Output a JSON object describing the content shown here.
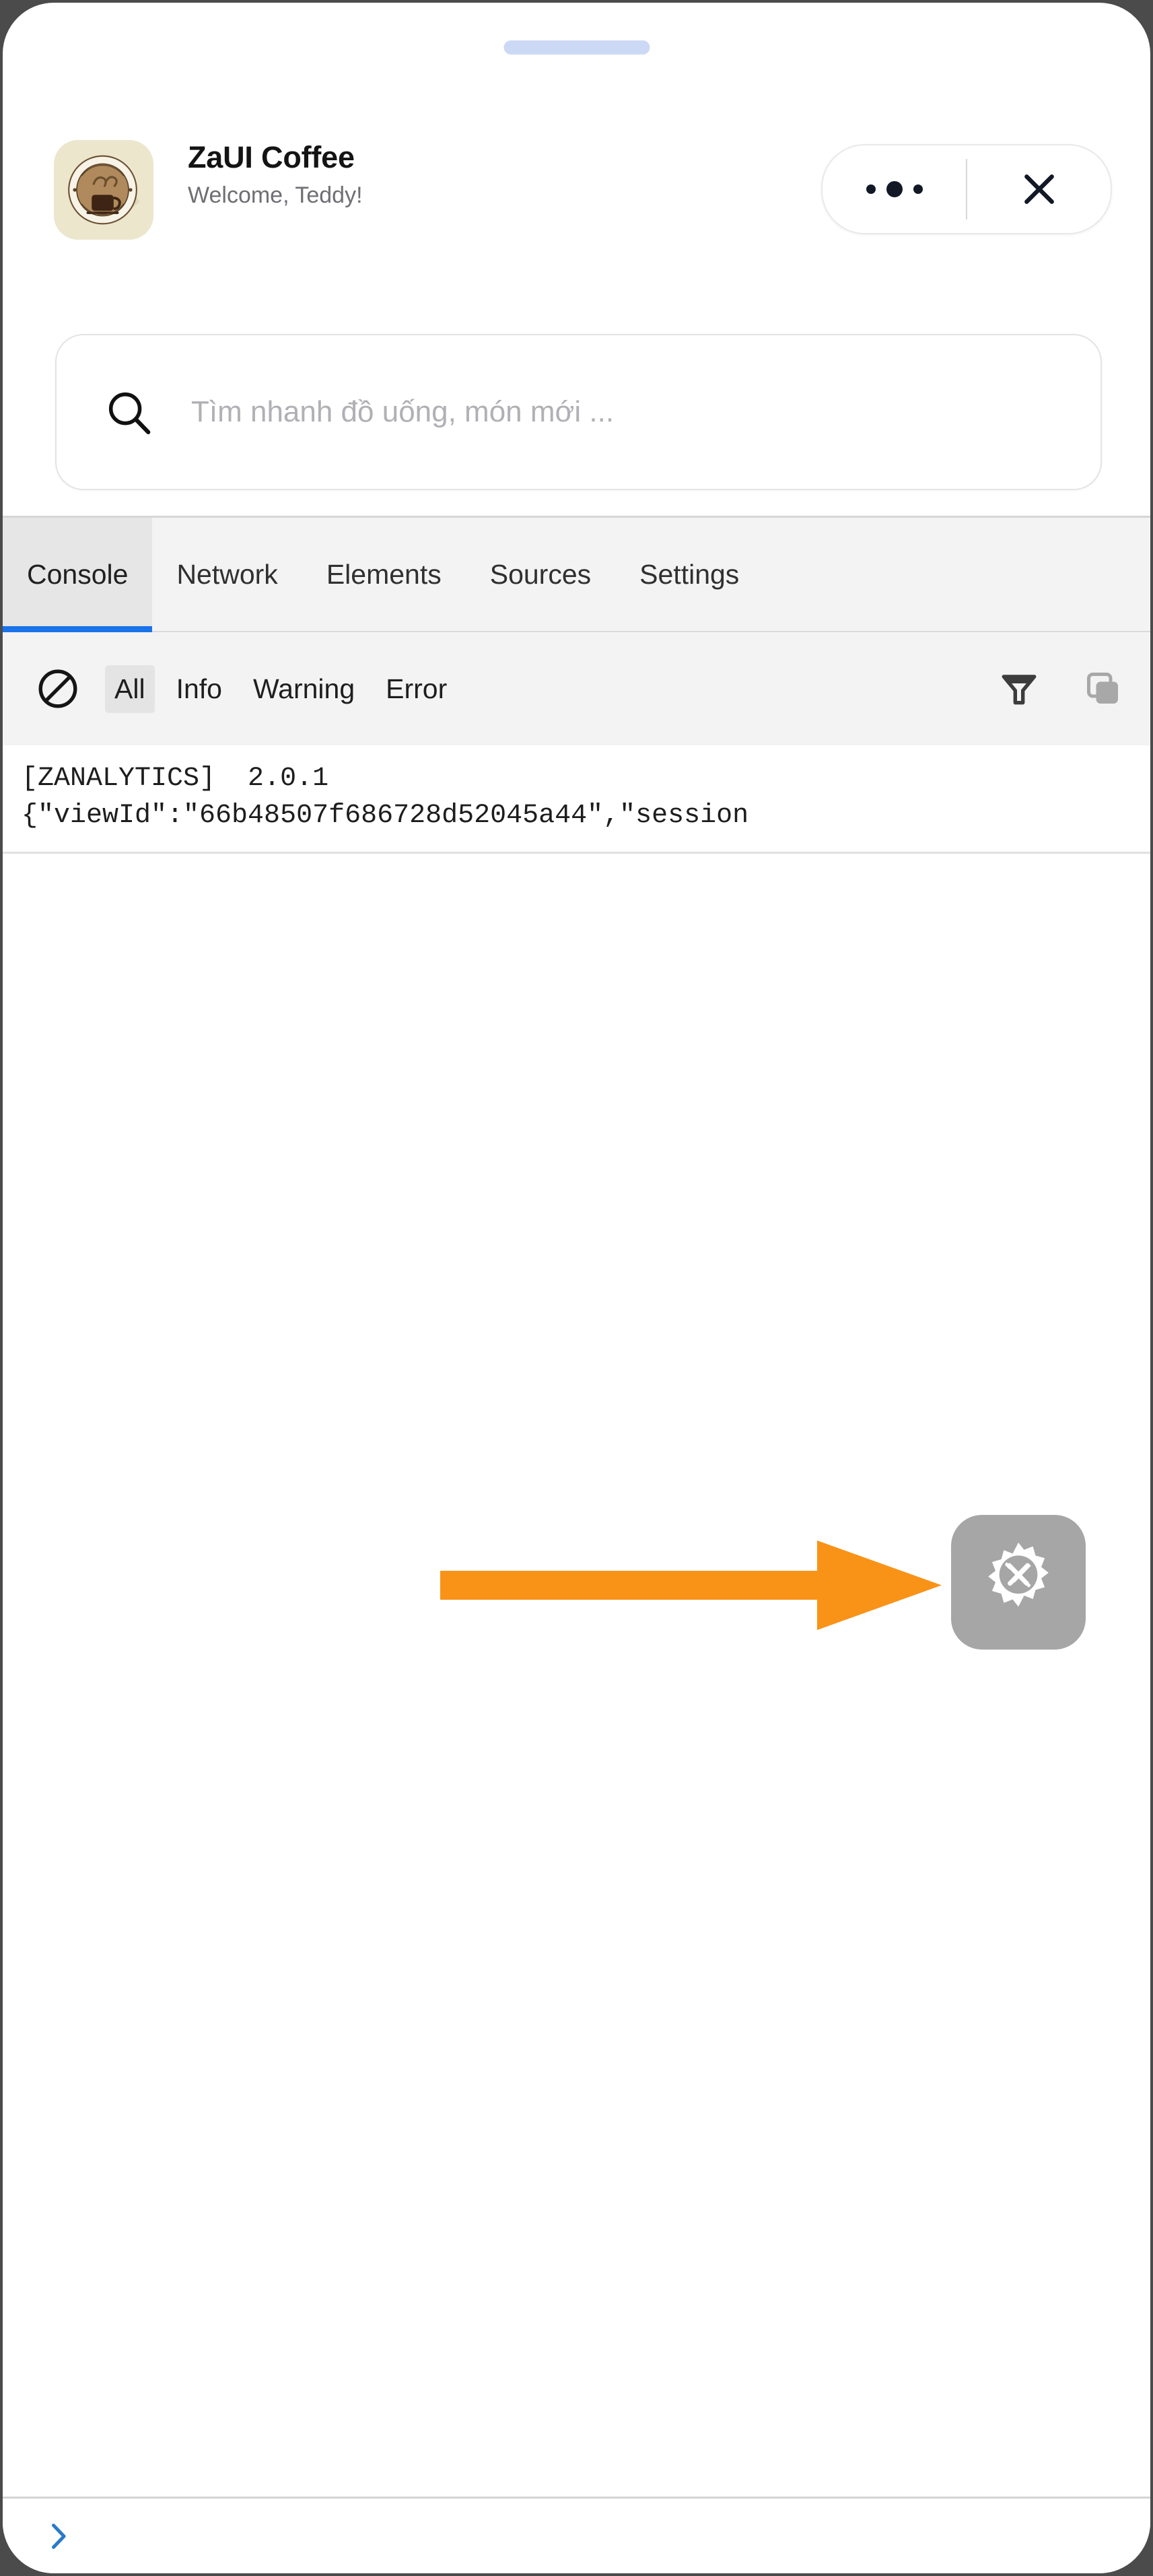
{
  "window": {
    "outer_background": "#4b4b4b",
    "frame_background": "#ffffff",
    "drag_handle_color": "#ccd9f5"
  },
  "app_header": {
    "logo_name": "zaui-coffee-logo",
    "logo_background": "#ece6cd",
    "title": "ZaUI Coffee",
    "subtitle": "Welcome, Teddy!",
    "controls": {
      "more_options_label": "•••",
      "more_options_icon": "three-dots-icon",
      "close_icon": "close-icon"
    }
  },
  "search": {
    "icon": "search-icon",
    "value": "",
    "placeholder": "Tìm nhanh đồ uống, món mới ..."
  },
  "devtools": {
    "tabs": [
      {
        "label": "Console",
        "active": true
      },
      {
        "label": "Network",
        "active": false
      },
      {
        "label": "Elements",
        "active": false
      },
      {
        "label": "Sources",
        "active": false
      },
      {
        "label": "Settings",
        "active": false
      }
    ],
    "active_tab_underline_color": "#1a73e8",
    "filterbar": {
      "clear_icon": "clear-console-icon",
      "levels": [
        {
          "label": "All",
          "selected": true
        },
        {
          "label": "Info",
          "selected": false
        },
        {
          "label": "Warning",
          "selected": false
        },
        {
          "label": "Error",
          "selected": false
        }
      ],
      "filter_icon": "funnel-filter-icon",
      "copy_icon": "copy-icon"
    },
    "console_rows": [
      {
        "lines": [
          "[ZANALYTICS]  2.0.1",
          "{\"viewId\":\"66b48507f686728d52045a44\",\"session"
        ]
      }
    ],
    "prompt_symbol": "chevron-right-icon",
    "prompt_color": "#1a73e8",
    "prompt_value": ""
  },
  "floating_button": {
    "name": "devtools-toggle-button",
    "icon": "gear-tools-icon",
    "background": "#a6a6a6"
  },
  "annotation": {
    "arrow_color": "#f99318",
    "arrow_direction": "right"
  }
}
